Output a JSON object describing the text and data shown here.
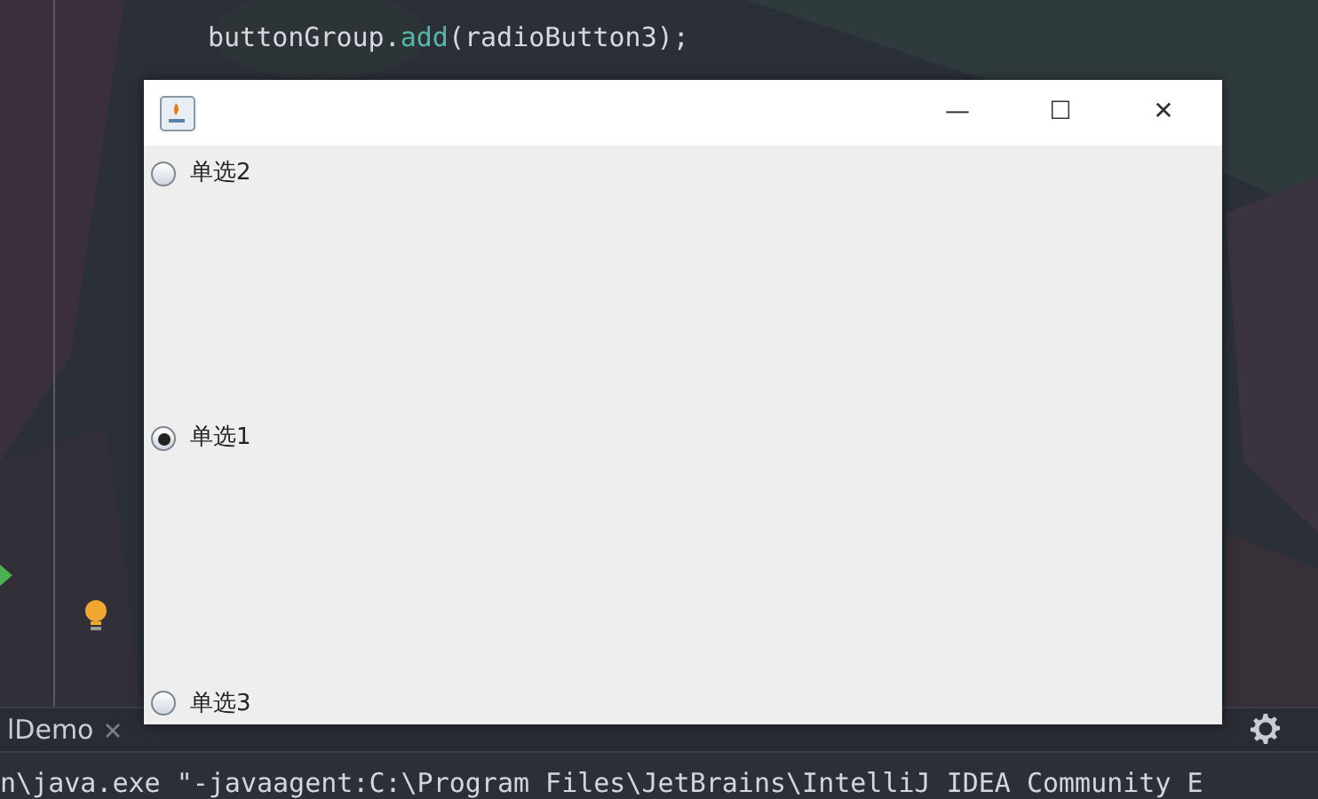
{
  "editor": {
    "code_line": [
      {
        "text": "buttonGroup.",
        "kind": "plain"
      },
      {
        "text": "add",
        "kind": "method"
      },
      {
        "text": "(radioButton3);",
        "kind": "plain"
      }
    ]
  },
  "window": {
    "buttons": [
      "—",
      "☐",
      "✕"
    ],
    "radios": [
      {
        "label": "单选2",
        "selected": false
      },
      {
        "label": "单选1",
        "selected": true
      },
      {
        "label": "单选3",
        "selected": false
      }
    ]
  },
  "tabs": [
    {
      "label": "lDemo",
      "closable": true
    }
  ],
  "console": "n\\java.exe \"-javaagent:C:\\Program Files\\JetBrains\\IntelliJ IDEA Community E"
}
